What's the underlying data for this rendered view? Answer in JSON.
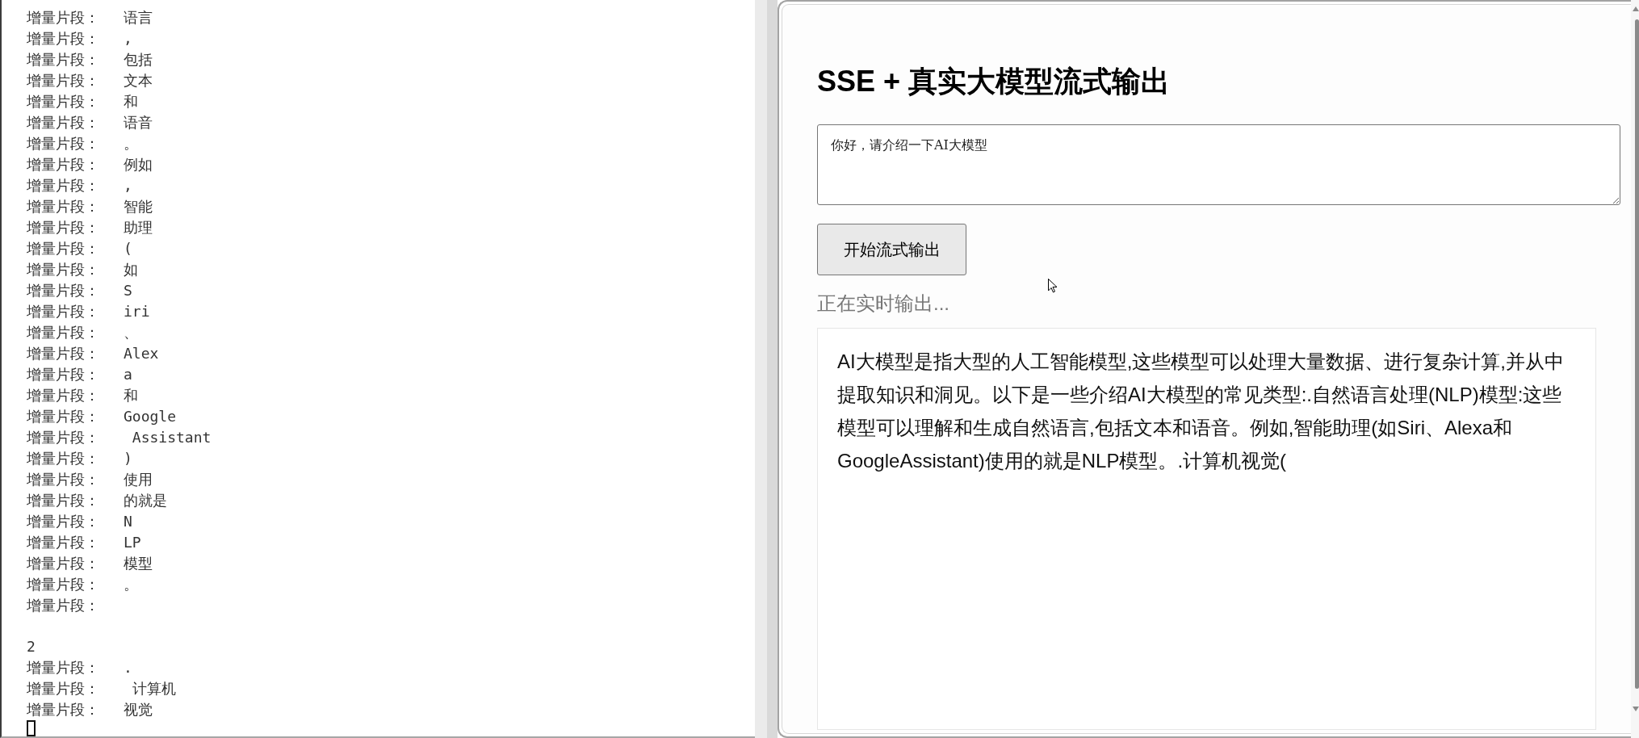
{
  "terminal": {
    "lines": [
      {
        "kind": "chunk",
        "label": "增量片段：",
        "value": "语言"
      },
      {
        "kind": "chunk",
        "label": "增量片段：",
        "value": ","
      },
      {
        "kind": "chunk",
        "label": "增量片段：",
        "value": "包括"
      },
      {
        "kind": "chunk",
        "label": "增量片段：",
        "value": "文本"
      },
      {
        "kind": "chunk",
        "label": "增量片段：",
        "value": "和"
      },
      {
        "kind": "chunk",
        "label": "增量片段：",
        "value": "语音"
      },
      {
        "kind": "chunk",
        "label": "增量片段：",
        "value": "。"
      },
      {
        "kind": "chunk",
        "label": "增量片段：",
        "value": "例如"
      },
      {
        "kind": "chunk",
        "label": "增量片段：",
        "value": ","
      },
      {
        "kind": "chunk",
        "label": "增量片段：",
        "value": "智能"
      },
      {
        "kind": "chunk",
        "label": "增量片段：",
        "value": "助理"
      },
      {
        "kind": "chunk",
        "label": "增量片段：",
        "value": "("
      },
      {
        "kind": "chunk",
        "label": "增量片段：",
        "value": "如"
      },
      {
        "kind": "chunk",
        "label": "增量片段：",
        "value": "S"
      },
      {
        "kind": "chunk",
        "label": "增量片段：",
        "value": "iri"
      },
      {
        "kind": "chunk",
        "label": "增量片段：",
        "value": "、"
      },
      {
        "kind": "chunk",
        "label": "增量片段：",
        "value": "Alex"
      },
      {
        "kind": "chunk",
        "label": "增量片段：",
        "value": "a"
      },
      {
        "kind": "chunk",
        "label": "增量片段：",
        "value": "和"
      },
      {
        "kind": "chunk",
        "label": "增量片段：",
        "value": "Google"
      },
      {
        "kind": "chunk",
        "label": "增量片段：",
        "value": " Assistant"
      },
      {
        "kind": "chunk",
        "label": "增量片段：",
        "value": ")"
      },
      {
        "kind": "chunk",
        "label": "增量片段：",
        "value": "使用"
      },
      {
        "kind": "chunk",
        "label": "增量片段：",
        "value": "的就是"
      },
      {
        "kind": "chunk",
        "label": "增量片段：",
        "value": "N"
      },
      {
        "kind": "chunk",
        "label": "增量片段：",
        "value": "LP"
      },
      {
        "kind": "chunk",
        "label": "增量片段：",
        "value": "模型"
      },
      {
        "kind": "chunk",
        "label": "增量片段：",
        "value": "。"
      },
      {
        "kind": "chunk",
        "label": "增量片段："
      },
      {
        "kind": "blank"
      },
      {
        "kind": "plain",
        "text": "2"
      },
      {
        "kind": "chunk",
        "label": "增量片段：",
        "value": "."
      },
      {
        "kind": "chunk",
        "label": "增量片段：",
        "value": " 计算机"
      },
      {
        "kind": "chunk",
        "label": "增量片段：",
        "value": "视觉"
      }
    ]
  },
  "page": {
    "title": "SSE + 真实大模型流式输出",
    "prompt": {
      "value": "你好，请介绍一下AI大模型"
    },
    "start_button": "开始流式输出",
    "status": "正在实时输出...",
    "output": "AI大模型是指大型的人工智能模型,这些模型可以处理大量数据、进行复杂计算,并从中提取知识和洞见。以下是一些介绍AI大模型的常见类型:.自然语言处理(NLP)模型:这些模型可以理解和生成自然语言,包括文本和语音。例如,智能助理(如Siri、Alexa和GoogleAssistant)使用的就是NLP模型。.计算机视觉("
  }
}
